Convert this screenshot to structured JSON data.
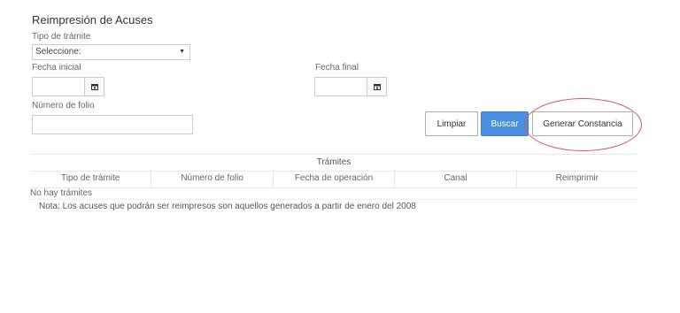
{
  "page": {
    "title": "Reimpresión de Acuses"
  },
  "form": {
    "tramite_label": "Tipo de trámite",
    "tramite_value": "Seleccione:",
    "fecha_inicial_label": "Fecha inicial",
    "fecha_final_label": "Fecha final",
    "folio_label": "Número de folio",
    "folio_value": ""
  },
  "buttons": {
    "limpiar": "Limpiar",
    "buscar": "Buscar",
    "generar": "Generar Constancia"
  },
  "table": {
    "caption": "Trámites",
    "headers": [
      "Tipo de trámite",
      "Número de folio",
      "Fecha de operación",
      "Canal",
      "Reimprimir"
    ],
    "empty_text": "No hay trámites"
  },
  "note": "Nota: Los acuses que podrán ser reimpresos son aquellos generados a partir de enero del 2008",
  "colors": {
    "primary": "#4a8fe0",
    "highlight": "#e0505a"
  }
}
